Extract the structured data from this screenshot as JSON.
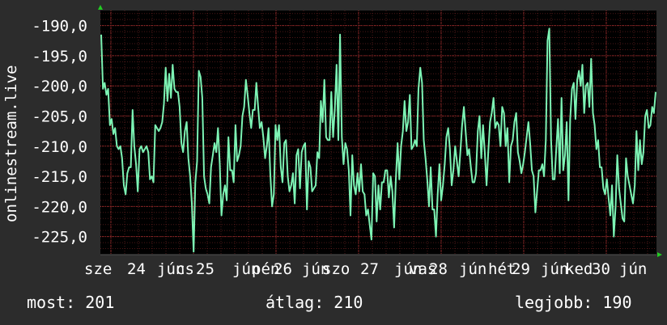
{
  "chart_data": {
    "type": "line",
    "ylabel": "onlinestream.live",
    "ylim": [
      -228,
      -187.5
    ],
    "y_ticks": [
      "-190,0",
      "-195,0",
      "-200,0",
      "-205,0",
      "-210,0",
      "-215,0",
      "-220,0",
      "-225,0"
    ],
    "y_tick_values": [
      -190,
      -195,
      -200,
      -205,
      -210,
      -215,
      -220,
      -225
    ],
    "x_tick_labels": [
      "sze 24 jún",
      "csü 25 jún",
      "pén 26 jún",
      "szo 27 jún",
      "vas 28 jún",
      "hét 29 jún",
      "ked 30 jún"
    ],
    "x_tick_labels_visible": [
      "sze",
      "24",
      "jún",
      "cs",
      "25",
      "jún",
      "pén",
      "26",
      "jún",
      "szo",
      "27",
      "jún",
      "vas",
      "28",
      "jún",
      "hét",
      "29",
      "jún",
      "ked",
      "30",
      "jún"
    ],
    "grid": true,
    "colors": {
      "line": "#7df3b4",
      "grid": "#8a2b2b",
      "background": "#000000",
      "axis_arrow": "#22cc22"
    },
    "series": [
      {
        "values": [
          -191.5,
          -200.5,
          -199.5,
          -201.5,
          -200.5,
          -206.5,
          -205.5,
          -208,
          -207,
          -210,
          -210.5,
          -210,
          -212,
          -216.5,
          -218,
          -214.5,
          -213.5,
          -213.5,
          -204,
          -210,
          -213,
          -217.5,
          -210.5,
          -210,
          -211,
          -210.5,
          -210,
          -211,
          -215.5,
          -215,
          -216,
          -206.5,
          -207,
          -207.5,
          -207,
          -206,
          -203,
          -197,
          -202.5,
          -198,
          -202,
          -196.5,
          -200.5,
          -201,
          -201,
          -203.5,
          -209.5,
          -211,
          -207.5,
          -206,
          -212,
          -215,
          -219.5,
          -227.5,
          -216,
          -212.5,
          -197.5,
          -198.5,
          -202,
          -215,
          -217,
          -218,
          -219.5,
          -213.5,
          -211.5,
          -209.5,
          -211,
          -207,
          -213,
          -221.5,
          -218,
          -216.5,
          -219,
          -208.5,
          -214,
          -214,
          -216,
          -206.5,
          -212.5,
          -211.5,
          -210,
          -205,
          -203.5,
          -199,
          -201.5,
          -204.5,
          -207,
          -204,
          -204,
          -199.5,
          -203.5,
          -207,
          -206,
          -208.5,
          -212,
          -210,
          -207,
          -214.5,
          -220,
          -218,
          -206.5,
          -209,
          -206.5,
          -213.5,
          -216,
          -209.5,
          -209,
          -215,
          -217.5,
          -216.5,
          -214.5,
          -219.5,
          -211.5,
          -210.5,
          -217,
          -211,
          -210,
          -209.5,
          -220.5,
          -212.5,
          -213.5,
          -217.5,
          -217,
          -216.5,
          -211,
          -212,
          -202.5,
          -206,
          -199,
          -208.5,
          -209,
          -209,
          -201,
          -208.5,
          -204,
          -196.5,
          -209,
          -191.5,
          -208.5,
          -213,
          -209.5,
          -210.5,
          -214,
          -221.5,
          -211.5,
          -216.5,
          -218,
          -214.5,
          -217.5,
          -213,
          -217.5,
          -218,
          -221.5,
          -220.5,
          -223,
          -225.5,
          -214.5,
          -215,
          -222.5,
          -216.5,
          -220.5,
          -216,
          -216,
          -214,
          -214,
          -218.5,
          -215,
          -217.5,
          -223.5,
          -215.5,
          -209.5,
          -215.5,
          -210,
          -207.5,
          -202.5,
          -207.5,
          -206,
          -201.5,
          -210.5,
          -210,
          -209,
          -210,
          -200.5,
          -197,
          -199.5,
          -209,
          -212,
          -215.5,
          -220,
          -213.5,
          -220.5,
          -220.5,
          -225,
          -218,
          -213,
          -219,
          -216.5,
          -213,
          -208.5,
          -207,
          -210.5,
          -216.5,
          -214,
          -210,
          -212.5,
          -215,
          -211,
          -206.5,
          -203.5,
          -207.5,
          -211.5,
          -210.5,
          -213.5,
          -216,
          -216,
          -214.5,
          -207.5,
          -205,
          -212,
          -206.5,
          -211,
          -216.5,
          -211,
          -206,
          -204.5,
          -202,
          -207,
          -206,
          -206.5,
          -210,
          -203.5,
          -204.5,
          -210,
          -207,
          -216,
          -210,
          -209,
          -206,
          -204.5,
          -211,
          -212.5,
          -214.5,
          -213,
          -211,
          -208.5,
          -206,
          -209.5,
          -214,
          -215,
          -221,
          -217.5,
          -214,
          -214,
          -213,
          -215,
          -209,
          -192.5,
          -190.5,
          -209,
          -215.5,
          -215.5,
          -210.5,
          -205.5,
          -214.5,
          -202,
          -214,
          -211.5,
          -206,
          -219,
          -205.5,
          -200.5,
          -199.5,
          -205.5,
          -199,
          -197.5,
          -200,
          -196.5,
          -204.5,
          -200,
          -199.5,
          -203.5,
          -195.5,
          -204.5,
          -206.5,
          -210.5,
          -209,
          -213.5,
          -213.5,
          -217,
          -218,
          -215.5,
          -218.5,
          -221.5,
          -216.5,
          -225,
          -220,
          -211.5,
          -217,
          -219.5,
          -222,
          -222.5,
          -212,
          -215,
          -216.5,
          -218,
          -219.5,
          -216.5,
          -207.5,
          -214,
          -209,
          -213,
          -211,
          -205,
          -204,
          -207,
          -206.5,
          -203.5,
          -204.5,
          -201
        ]
      }
    ]
  },
  "stats": {
    "now": "most: 201",
    "avg": "átlag: 210",
    "best": "legjobb: 190"
  }
}
